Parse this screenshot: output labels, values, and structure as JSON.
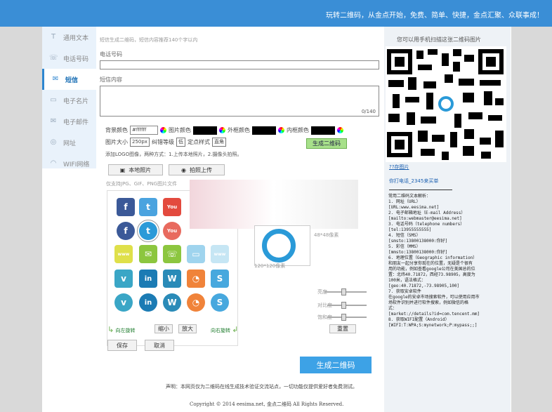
{
  "header": {
    "slogan": "玩转二维码，从金点开始，免费、简单、快捷，金点汇聚、众联事成！"
  },
  "sidebar": {
    "items": [
      {
        "label": "通用文本",
        "icon": "text-icon"
      },
      {
        "label": "电话号码",
        "icon": "phone-icon"
      },
      {
        "label": "短信",
        "icon": "sms-icon"
      },
      {
        "label": "电子名片",
        "icon": "card-icon"
      },
      {
        "label": "电子邮件",
        "icon": "mail-icon"
      },
      {
        "label": "网址",
        "icon": "globe-icon"
      },
      {
        "label": "WIFI网络",
        "icon": "wifi-icon"
      }
    ],
    "active": 2
  },
  "form": {
    "hint": "短信生成二维码，短信内容推荐140个字以内",
    "phone_label": "电话号码",
    "content_label": "短信内容",
    "counter": "0/140",
    "bg_color_label": "背景颜色",
    "bg_color_value": "#ffffff",
    "img_color_label": "图片颜色",
    "outer_color_label": "外框颜色",
    "inner_color_label": "内框颜色",
    "size_label": "图片大小",
    "size_value": "250px",
    "error_label": "纠错等级",
    "error_value": "低",
    "locate_label": "定点样式",
    "locate_value": "直角",
    "gen_small": "生成二维码",
    "logo_hint": "添加LOGO图像，两种方式：1.上传本地照片，2.摄像头拍照。",
    "local_btn": "本地照片",
    "camera_btn": "拍照上传",
    "format_hint": "仅支持JPG、GIF、PNG图片文件",
    "rotate_left": "向左旋转",
    "zoom_out": "缩小",
    "zoom_in": "放大",
    "rotate_right": "向右旋转",
    "save_btn": "保存",
    "cancel_btn": "取消",
    "size48": "48*48像素",
    "size120": "120*120像素",
    "slider_labels": [
      "亮度",
      "对比度",
      "饱和度"
    ],
    "reset_btn": "重置",
    "generate_btn": "生成二维码"
  },
  "footer": {
    "disclaimer": "声明：本网页仅为二维码在线生成技术验证交流站点，一切功能仅提供爱好者免费测试。",
    "copyright": "Copyright © 2014 eesima.net, 金点二维码 All Rights Reserved."
  },
  "right": {
    "title": "您可以用手机扫描这张二维码图片",
    "link1": "??存图片",
    "link2": "你打电话_2345来买单",
    "help": "常用二维码文本解析：\n1. 网址（URL）\n[URL:www.eesima.net]\n2. 电子邮箱地址（E-mail Address）\n[mailto:webmaster@eesima.net]\n3. 电话号码（telephone numbers）\n[tel:13955555555]\n4. 短信（SMS）\n[smsto:13800138000:你好]\n5. 彩信（MMS）\n[mmsto:13800138000:你好]\n6. 地理位置（Geographic information）\n和朋友一起分享你现在的位置，无疑是个很有\n用的功能，例如查看google公司在美国总的位\n置：北纬40.71872，西经73.98905，高度为\n100米，语法格式：\n[geo:40.71872,-73.98905,100]\n7. 获取安卓软件\n在google的安卓市场搜索软件，可以使用应用市\n场软件识别并进行软件搜索，例如微信的格\n式：\n[market://details?id=com.tencent.mm]\n8. 获取WIFI配置（Android）\n[WIFI:T:WPA;S:mynetwork;P:mypass;;]"
  }
}
